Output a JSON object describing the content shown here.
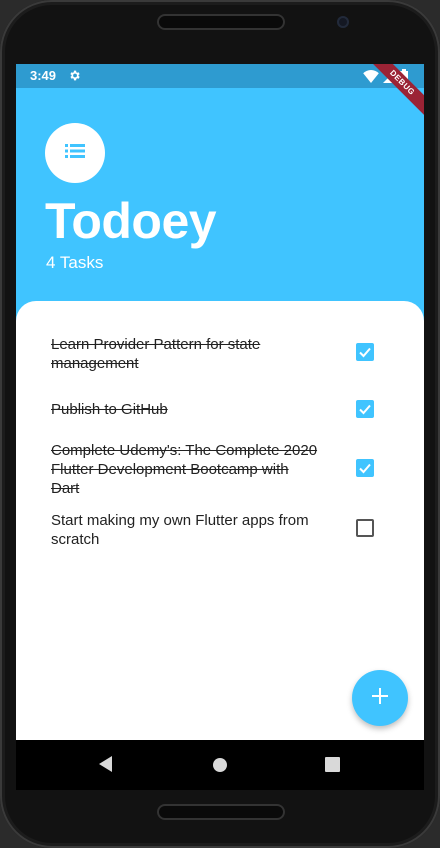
{
  "status_bar": {
    "time": "3:49",
    "debug_label": "DEBUG"
  },
  "header": {
    "icon": "list-icon",
    "title": "Todoey",
    "task_count": "4 Tasks"
  },
  "tasks": [
    {
      "label": "Learn Provider Pattern for state management",
      "checked": true
    },
    {
      "label": "Publish to GitHub",
      "checked": true
    },
    {
      "label": "Complete Udemy's: The Complete 2020 Flutter Development Bootcamp with Dart",
      "checked": true
    },
    {
      "label": "Start making my own Flutter apps from scratch",
      "checked": false
    }
  ],
  "fab": {
    "icon": "plus-icon"
  },
  "nav": {
    "back": "back-icon",
    "home": "home-icon",
    "recents": "recents-icon"
  },
  "colors": {
    "accent": "#40c4ff",
    "status": "#2e9bd0"
  }
}
